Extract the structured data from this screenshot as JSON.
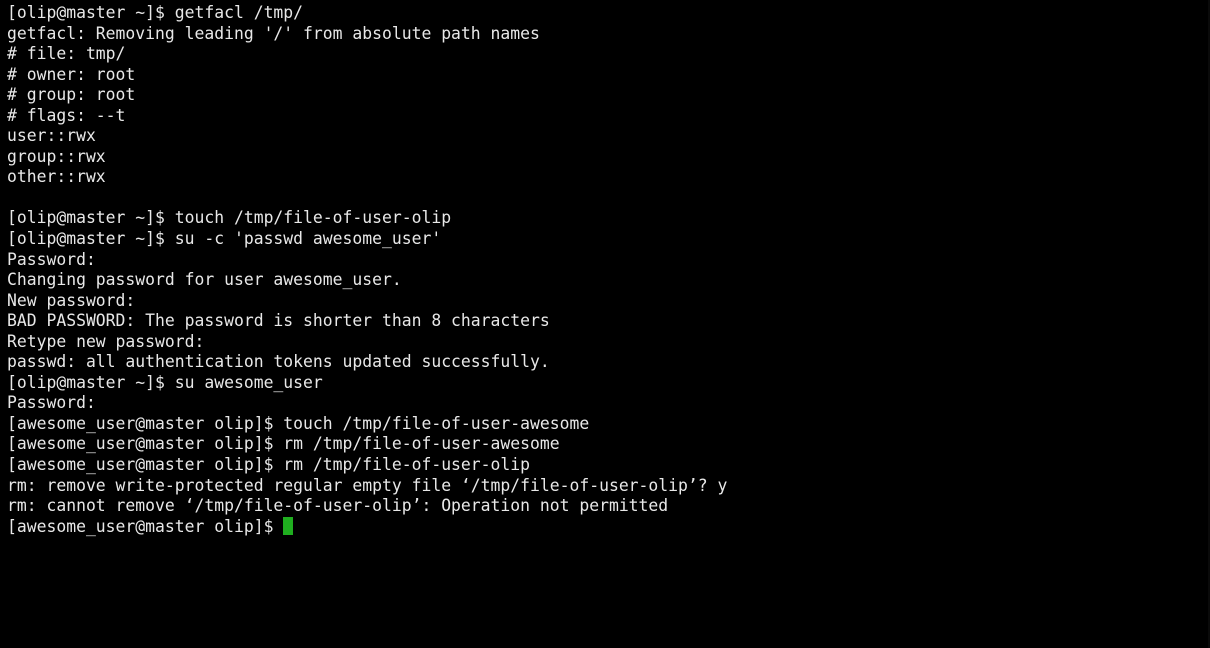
{
  "terminal": {
    "lines": [
      "[olip@master ~]$ getfacl /tmp/",
      "getfacl: Removing leading '/' from absolute path names",
      "# file: tmp/",
      "# owner: root",
      "# group: root",
      "# flags: --t",
      "user::rwx",
      "group::rwx",
      "other::rwx",
      "",
      "[olip@master ~]$ touch /tmp/file-of-user-olip",
      "[olip@master ~]$ su -c 'passwd awesome_user'",
      "Password:",
      "Changing password for user awesome_user.",
      "New password:",
      "BAD PASSWORD: The password is shorter than 8 characters",
      "Retype new password:",
      "passwd: all authentication tokens updated successfully.",
      "[olip@master ~]$ su awesome_user",
      "Password:",
      "[awesome_user@master olip]$ touch /tmp/file-of-user-awesome",
      "[awesome_user@master olip]$ rm /tmp/file-of-user-awesome",
      "[awesome_user@master olip]$ rm /tmp/file-of-user-olip",
      "rm: remove write-protected regular empty file ‘/tmp/file-of-user-olip’? y",
      "rm: cannot remove ‘/tmp/file-of-user-olip’: Operation not permitted"
    ],
    "prompt": "[awesome_user@master olip]$ ",
    "colors": {
      "background": "#000000",
      "foreground": "#e8e8e8",
      "cursor": "#1fae1f"
    }
  }
}
